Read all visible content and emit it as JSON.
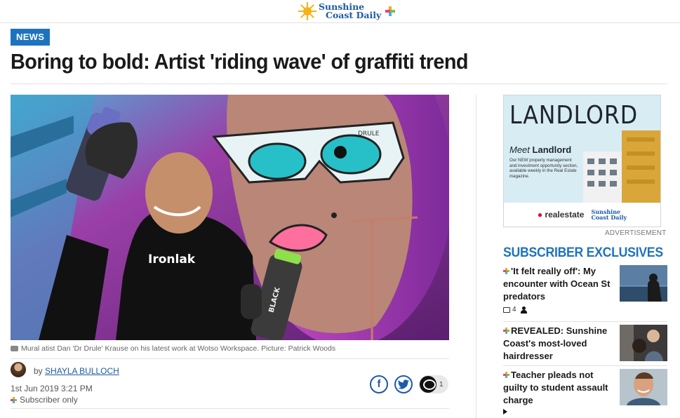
{
  "site": {
    "logo_line1": "Sunshine",
    "logo_line2": "Coast Daily",
    "accent": "#1e73be",
    "brand_blue": "#1e5aa8",
    "sun_color": "#f6b21b"
  },
  "article": {
    "category": "NEWS",
    "headline": "Boring to bold: Artist 'riding wave' of graffiti trend",
    "caption": "Mural atist Dan 'Dr Drule' Krause on his latest work at Wotso Workspace. Picture: Patrick Woods",
    "photo_hoodie_text": "Ironlak",
    "photo_can_text": "BLACK",
    "photo_glasses_text": "DRULE",
    "byline_prefix": "by",
    "author": "SHAYLA BULLOCH",
    "date": "1st Jun 2019 3:21 PM",
    "access": "Subscriber only",
    "share": {
      "facebook_icon": "facebook-icon",
      "twitter_icon": "twitter-icon",
      "comments_icon": "comment-bubble-icon",
      "comment_count": "1"
    }
  },
  "sidebar": {
    "ad": {
      "brand": "LANDLORD",
      "meet": "Landlord",
      "meet_prefix": "Meet",
      "blurb": "Our NEW property management and investment opportunity section, available weekly in the Real Estate magazine.",
      "partner1": "realestate",
      "partner2_line1": "Sunshine",
      "partner2_line2": "Coast Daily"
    },
    "ad_label": "ADVERTISEMENT",
    "section_title": "SUBSCRIBER EXCLUSIVES",
    "stories": [
      {
        "title": "'It felt really off': My encounter with Ocean St predators",
        "comments": "4"
      },
      {
        "title": "REVEALED: Sunshine Coast's most-loved hairdresser"
      },
      {
        "title": "Teacher pleads not guilty to student assault charge"
      }
    ]
  }
}
